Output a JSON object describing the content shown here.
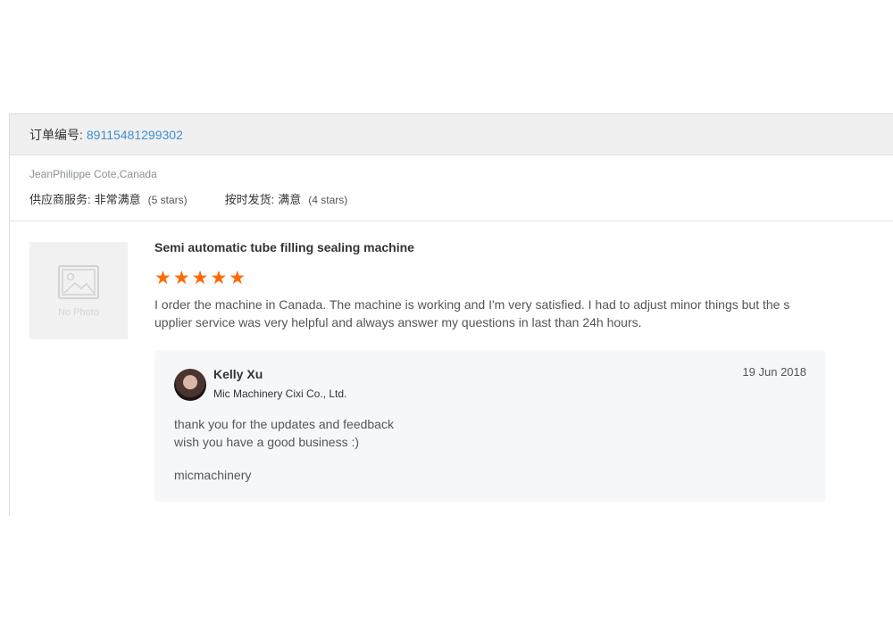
{
  "order": {
    "label": "订单编号:",
    "number": "89115481299302"
  },
  "buyer": {
    "name": "JeanPhilippe Cote,Canada"
  },
  "ratings": [
    {
      "label": "供应商服务:",
      "value": "非常满意",
      "stars_text": "(5 stars)"
    },
    {
      "label": "按时发货:",
      "value": "满意",
      "stars_text": "(4 stars)"
    }
  ],
  "product": {
    "no_photo": "No Photo",
    "title": "Semi automatic tube filling sealing machine",
    "rating": 5,
    "max_rating": 5,
    "review": "I order the machine in Canada. The machine is working and I'm very satisfied. I had to adjust minor things but the supplier service was very helpful and always answer my questions in last than 24h hours."
  },
  "reply": {
    "name": "Kelly Xu",
    "company": "Mic Machinery Cixi Co., Ltd.",
    "date": "19 Jun 2018",
    "line1": "thank you for the updates and feedback",
    "line2": "wish you have a good business :)",
    "signature": "micmachinery"
  },
  "colors": {
    "accent_link": "#3f8fd0",
    "star": "#ff6a00",
    "header_bg": "#f0f0f0",
    "reply_bg": "#f6f7f9"
  },
  "icons": {
    "photo_placeholder": "image-placeholder-icon",
    "star": "star-icon"
  }
}
